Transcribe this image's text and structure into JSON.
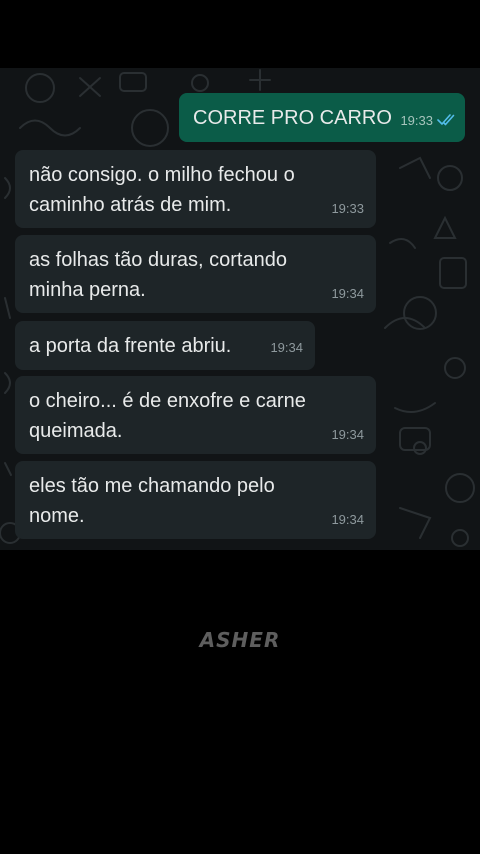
{
  "chat": {
    "outgoing": [
      {
        "text": "CORRE PRO CARRO",
        "time": "19:33",
        "status": "read"
      }
    ],
    "incoming": [
      {
        "text": "não consigo. o milho fechou o caminho atrás de mim.",
        "time": "19:33"
      },
      {
        "text": "as folhas tão duras, cortando minha perna.",
        "time": "19:34"
      },
      {
        "text": "a porta da frente abriu.",
        "time": "19:34"
      },
      {
        "text": "o cheiro... é de enxofre e carne queimada.",
        "time": "19:34"
      },
      {
        "text": "eles tão me chamando pelo nome.",
        "time": "19:34"
      }
    ]
  },
  "watermark": "ASHER",
  "colors": {
    "page_background": "#000000",
    "chat_background": "#111416",
    "incoming_bubble": "#1e2528",
    "outgoing_bubble": "#0b5c48",
    "read_ticks": "#53bdeb"
  },
  "icons": [
    "read-receipt-double-check-icon",
    "chat-doodle-wallpaper"
  ]
}
